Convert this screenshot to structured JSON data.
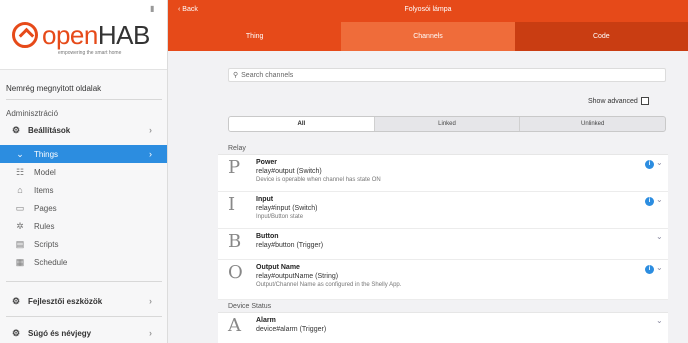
{
  "sidebar": {
    "logo_open": "open",
    "logo_hab": "HAB",
    "logo_tagline": "empowering the smart home",
    "recent_pages": "Nemrég megnyitott oldalak",
    "admin_heading": "Adminisztráció",
    "settings_label": "Beállítások",
    "items": [
      {
        "label": "Things",
        "icon": "thing-icon"
      },
      {
        "label": "Model",
        "icon": "model-icon"
      },
      {
        "label": "Items",
        "icon": "items-icon"
      },
      {
        "label": "Pages",
        "icon": "pages-icon"
      },
      {
        "label": "Rules",
        "icon": "rules-icon"
      },
      {
        "label": "Scripts",
        "icon": "scripts-icon"
      },
      {
        "label": "Schedule",
        "icon": "schedule-icon"
      }
    ],
    "dev_tools_label": "Fejlesztői eszközök",
    "help_label": "Súgó és névjegy"
  },
  "header": {
    "back_label": "Back",
    "title": "Folyosói lámpa",
    "tabs": [
      "Thing",
      "Channels",
      "Code"
    ],
    "active_tab": "Channels"
  },
  "main": {
    "search_placeholder": "Search channels",
    "show_advanced_label": "Show advanced",
    "filters": [
      "All",
      "Linked",
      "Unlinked"
    ],
    "active_filter": "All",
    "groups": [
      {
        "title": "Relay",
        "channels": [
          {
            "letter": "P",
            "name": "Power",
            "uid": "relay#output (Switch)",
            "desc": "Device is operable when channel has state ON",
            "info": true
          },
          {
            "letter": "I",
            "name": "Input",
            "uid": "relay#input (Switch)",
            "desc": "Input/Button state",
            "info": true
          },
          {
            "letter": "B",
            "name": "Button",
            "uid": "relay#button (Trigger)",
            "desc": "",
            "info": false
          },
          {
            "letter": "O",
            "name": "Output Name",
            "uid": "relay#outputName (String)",
            "desc": "Output/Channel Name as configured in the Shelly App.",
            "info": true
          }
        ]
      },
      {
        "title": "Device Status",
        "channels": [
          {
            "letter": "A",
            "name": "Alarm",
            "uid": "device#alarm (Trigger)",
            "desc": "",
            "info": false
          }
        ]
      }
    ],
    "info_symbol": "i",
    "colors": {
      "accent": "#e64a19",
      "active_item": "#2c8de0"
    }
  }
}
